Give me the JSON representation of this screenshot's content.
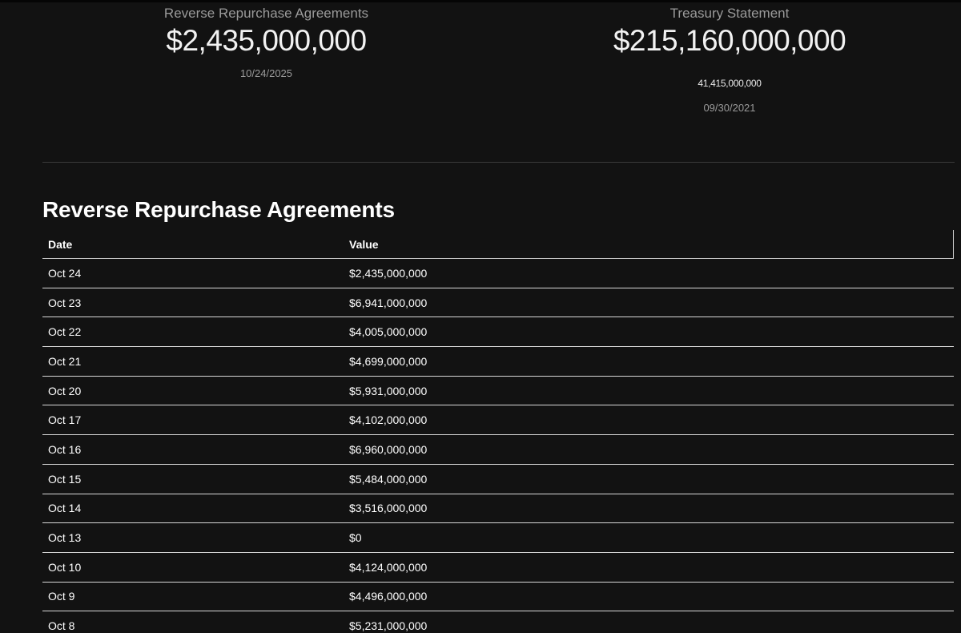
{
  "stats": {
    "reverse_repo": {
      "label": "Reverse Repurchase Agreements",
      "value": "$2,435,000,000",
      "date": "10/24/2025"
    },
    "treasury": {
      "label": "Treasury Statement",
      "value": "$215,160,000,000",
      "sub_value": "41,415,000,000",
      "date": "09/30/2021"
    }
  },
  "section": {
    "title": "Reverse Repurchase Agreements"
  },
  "table": {
    "headers": {
      "date": "Date",
      "value": "Value"
    },
    "rows": [
      {
        "date": "Oct 24",
        "value": "$2,435,000,000"
      },
      {
        "date": "Oct 23",
        "value": "$6,941,000,000"
      },
      {
        "date": "Oct 22",
        "value": "$4,005,000,000"
      },
      {
        "date": "Oct 21",
        "value": "$4,699,000,000"
      },
      {
        "date": "Oct 20",
        "value": "$5,931,000,000"
      },
      {
        "date": "Oct 17",
        "value": "$4,102,000,000"
      },
      {
        "date": "Oct 16",
        "value": "$6,960,000,000"
      },
      {
        "date": "Oct 15",
        "value": "$5,484,000,000"
      },
      {
        "date": "Oct 14",
        "value": "$3,516,000,000"
      },
      {
        "date": "Oct 13",
        "value": "$0"
      },
      {
        "date": "Oct 10",
        "value": "$4,124,000,000"
      },
      {
        "date": "Oct 9",
        "value": "$4,496,000,000"
      },
      {
        "date": "Oct 8",
        "value": "$5,231,000,000"
      }
    ]
  }
}
